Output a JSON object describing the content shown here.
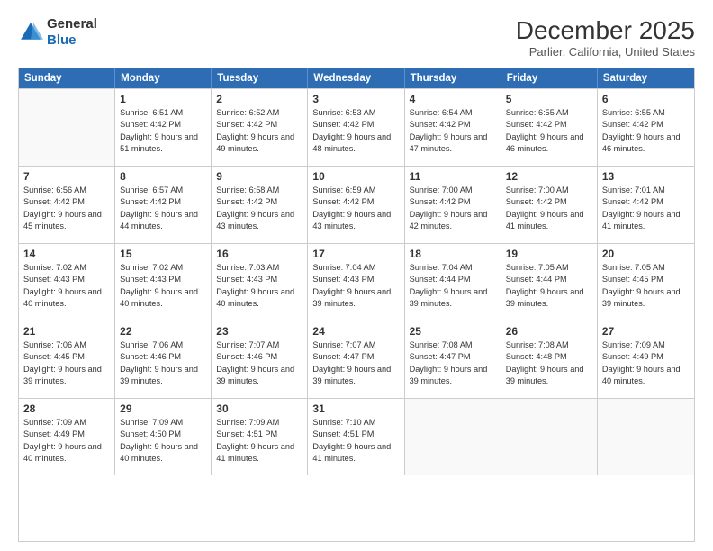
{
  "header": {
    "logo_line1": "General",
    "logo_line2": "Blue",
    "main_title": "December 2025",
    "subtitle": "Parlier, California, United States"
  },
  "calendar": {
    "days_of_week": [
      "Sunday",
      "Monday",
      "Tuesday",
      "Wednesday",
      "Thursday",
      "Friday",
      "Saturday"
    ],
    "rows": [
      [
        {
          "day": "",
          "empty": true
        },
        {
          "day": "1",
          "sunrise": "Sunrise: 6:51 AM",
          "sunset": "Sunset: 4:42 PM",
          "daylight": "Daylight: 9 hours and 51 minutes."
        },
        {
          "day": "2",
          "sunrise": "Sunrise: 6:52 AM",
          "sunset": "Sunset: 4:42 PM",
          "daylight": "Daylight: 9 hours and 49 minutes."
        },
        {
          "day": "3",
          "sunrise": "Sunrise: 6:53 AM",
          "sunset": "Sunset: 4:42 PM",
          "daylight": "Daylight: 9 hours and 48 minutes."
        },
        {
          "day": "4",
          "sunrise": "Sunrise: 6:54 AM",
          "sunset": "Sunset: 4:42 PM",
          "daylight": "Daylight: 9 hours and 47 minutes."
        },
        {
          "day": "5",
          "sunrise": "Sunrise: 6:55 AM",
          "sunset": "Sunset: 4:42 PM",
          "daylight": "Daylight: 9 hours and 46 minutes."
        },
        {
          "day": "6",
          "sunrise": "Sunrise: 6:55 AM",
          "sunset": "Sunset: 4:42 PM",
          "daylight": "Daylight: 9 hours and 46 minutes."
        }
      ],
      [
        {
          "day": "7",
          "sunrise": "Sunrise: 6:56 AM",
          "sunset": "Sunset: 4:42 PM",
          "daylight": "Daylight: 9 hours and 45 minutes."
        },
        {
          "day": "8",
          "sunrise": "Sunrise: 6:57 AM",
          "sunset": "Sunset: 4:42 PM",
          "daylight": "Daylight: 9 hours and 44 minutes."
        },
        {
          "day": "9",
          "sunrise": "Sunrise: 6:58 AM",
          "sunset": "Sunset: 4:42 PM",
          "daylight": "Daylight: 9 hours and 43 minutes."
        },
        {
          "day": "10",
          "sunrise": "Sunrise: 6:59 AM",
          "sunset": "Sunset: 4:42 PM",
          "daylight": "Daylight: 9 hours and 43 minutes."
        },
        {
          "day": "11",
          "sunrise": "Sunrise: 7:00 AM",
          "sunset": "Sunset: 4:42 PM",
          "daylight": "Daylight: 9 hours and 42 minutes."
        },
        {
          "day": "12",
          "sunrise": "Sunrise: 7:00 AM",
          "sunset": "Sunset: 4:42 PM",
          "daylight": "Daylight: 9 hours and 41 minutes."
        },
        {
          "day": "13",
          "sunrise": "Sunrise: 7:01 AM",
          "sunset": "Sunset: 4:42 PM",
          "daylight": "Daylight: 9 hours and 41 minutes."
        }
      ],
      [
        {
          "day": "14",
          "sunrise": "Sunrise: 7:02 AM",
          "sunset": "Sunset: 4:43 PM",
          "daylight": "Daylight: 9 hours and 40 minutes."
        },
        {
          "day": "15",
          "sunrise": "Sunrise: 7:02 AM",
          "sunset": "Sunset: 4:43 PM",
          "daylight": "Daylight: 9 hours and 40 minutes."
        },
        {
          "day": "16",
          "sunrise": "Sunrise: 7:03 AM",
          "sunset": "Sunset: 4:43 PM",
          "daylight": "Daylight: 9 hours and 40 minutes."
        },
        {
          "day": "17",
          "sunrise": "Sunrise: 7:04 AM",
          "sunset": "Sunset: 4:43 PM",
          "daylight": "Daylight: 9 hours and 39 minutes."
        },
        {
          "day": "18",
          "sunrise": "Sunrise: 7:04 AM",
          "sunset": "Sunset: 4:44 PM",
          "daylight": "Daylight: 9 hours and 39 minutes."
        },
        {
          "day": "19",
          "sunrise": "Sunrise: 7:05 AM",
          "sunset": "Sunset: 4:44 PM",
          "daylight": "Daylight: 9 hours and 39 minutes."
        },
        {
          "day": "20",
          "sunrise": "Sunrise: 7:05 AM",
          "sunset": "Sunset: 4:45 PM",
          "daylight": "Daylight: 9 hours and 39 minutes."
        }
      ],
      [
        {
          "day": "21",
          "sunrise": "Sunrise: 7:06 AM",
          "sunset": "Sunset: 4:45 PM",
          "daylight": "Daylight: 9 hours and 39 minutes."
        },
        {
          "day": "22",
          "sunrise": "Sunrise: 7:06 AM",
          "sunset": "Sunset: 4:46 PM",
          "daylight": "Daylight: 9 hours and 39 minutes."
        },
        {
          "day": "23",
          "sunrise": "Sunrise: 7:07 AM",
          "sunset": "Sunset: 4:46 PM",
          "daylight": "Daylight: 9 hours and 39 minutes."
        },
        {
          "day": "24",
          "sunrise": "Sunrise: 7:07 AM",
          "sunset": "Sunset: 4:47 PM",
          "daylight": "Daylight: 9 hours and 39 minutes."
        },
        {
          "day": "25",
          "sunrise": "Sunrise: 7:08 AM",
          "sunset": "Sunset: 4:47 PM",
          "daylight": "Daylight: 9 hours and 39 minutes."
        },
        {
          "day": "26",
          "sunrise": "Sunrise: 7:08 AM",
          "sunset": "Sunset: 4:48 PM",
          "daylight": "Daylight: 9 hours and 39 minutes."
        },
        {
          "day": "27",
          "sunrise": "Sunrise: 7:09 AM",
          "sunset": "Sunset: 4:49 PM",
          "daylight": "Daylight: 9 hours and 40 minutes."
        }
      ],
      [
        {
          "day": "28",
          "sunrise": "Sunrise: 7:09 AM",
          "sunset": "Sunset: 4:49 PM",
          "daylight": "Daylight: 9 hours and 40 minutes."
        },
        {
          "day": "29",
          "sunrise": "Sunrise: 7:09 AM",
          "sunset": "Sunset: 4:50 PM",
          "daylight": "Daylight: 9 hours and 40 minutes."
        },
        {
          "day": "30",
          "sunrise": "Sunrise: 7:09 AM",
          "sunset": "Sunset: 4:51 PM",
          "daylight": "Daylight: 9 hours and 41 minutes."
        },
        {
          "day": "31",
          "sunrise": "Sunrise: 7:10 AM",
          "sunset": "Sunset: 4:51 PM",
          "daylight": "Daylight: 9 hours and 41 minutes."
        },
        {
          "day": "",
          "empty": true
        },
        {
          "day": "",
          "empty": true
        },
        {
          "day": "",
          "empty": true
        }
      ]
    ]
  }
}
